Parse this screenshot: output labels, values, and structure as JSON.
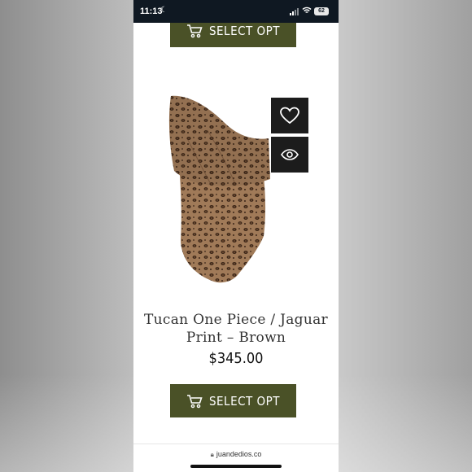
{
  "status_bar": {
    "time": "11:13",
    "battery": "62"
  },
  "buttons": {
    "select_top": "SELECT OPT",
    "select_bottom": "SELECT OPT"
  },
  "product": {
    "title_line1": "Tucan One Piece / Jaguar",
    "title_line2": "Print – Brown",
    "price": "$345.00"
  },
  "icons": [
    "moon-icon",
    "signal-icon",
    "wifi-icon",
    "battery-icon",
    "cart-icon",
    "heart-icon",
    "eye-icon",
    "lock-icon"
  ],
  "browser": {
    "url": "juandedios.co"
  },
  "colors": {
    "button_bg": "#4a5127",
    "icon_box_bg": "#1c1c1c",
    "status_bar_bg": "#0f1822"
  }
}
